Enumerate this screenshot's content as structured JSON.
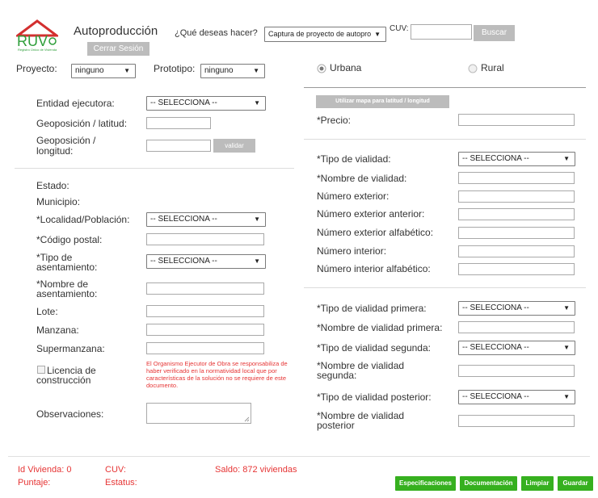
{
  "header": {
    "logo_text": "RUV",
    "logo_sub": "Registro Único de Vivienda",
    "app_title": "Autoproducción",
    "question": "¿Qué deseas hacer?",
    "action_select": "Captura de proyecto de autopro",
    "cuv_label": "CUV:",
    "cuv_value": "",
    "search_btn": "Buscar",
    "logout_btn": "Cerrar Sesión"
  },
  "filters": {
    "proyecto_label": "Proyecto:",
    "proyecto_value": "ninguno",
    "prototipo_label": "Prototipo:",
    "prototipo_value": "ninguno",
    "urbana": "Urbana",
    "rural": "Rural"
  },
  "left": {
    "entidad_label": "Entidad ejecutora:",
    "entidad_value": "-- SELECCIONA --",
    "lat_label": "Geoposición / latitud:",
    "lon_label_1": "Geoposición /",
    "lon_label_2": "longitud:",
    "validar_btn": "validar",
    "estado_label": "Estado:",
    "municipio_label": "Municipio:",
    "localidad_label": "*Localidad/Población:",
    "localidad_value": "-- SELECCIONA --",
    "cp_label": "*Código postal:",
    "tipo_asent_1": "*Tipo de",
    "tipo_asent_2": "asentamiento:",
    "tipo_asent_value": "-- SELECCIONA --",
    "nombre_asent_1": "*Nombre de",
    "nombre_asent_2": "asentamiento:",
    "lote_label": "Lote:",
    "manzana_label": "Manzana:",
    "supermanzana_label": "Supermanzana:",
    "licencia_1": "Licencia de",
    "licencia_2": "construcción",
    "licencia_note": "El Organismo Ejecutor de Obra se responsabiliza de haber verificado en la normatividad local que por características de la solución no se requiere de este documento.",
    "observaciones_label": "Observaciones:"
  },
  "right": {
    "mapa_btn": "Utilizar mapa para latitud / longitud",
    "precio_label": "*Precio:",
    "tipo_vialidad_label": "*Tipo de vialidad:",
    "tipo_vialidad_value": "-- SELECCIONA --",
    "nombre_vialidad_label": "*Nombre de vialidad:",
    "num_ext_label": "Número exterior:",
    "num_ext_ant_label": "Número exterior anterior:",
    "num_ext_alf_label": "Número exterior alfabético:",
    "num_int_label": "Número interior:",
    "num_int_alf_label": "Número interior alfabético:",
    "tipo_v1_label": "*Tipo de vialidad primera:",
    "tipo_v1_value": "-- SELECCIONA --",
    "nombre_v1_label": "*Nombre de vialidad primera:",
    "tipo_v2_label": "*Tipo de vialidad segunda:",
    "tipo_v2_value": "-- SELECCIONA --",
    "nombre_v2_1": "*Nombre de vialidad",
    "nombre_v2_2": "segunda:",
    "tipo_vp_label": "*Tipo de vialidad posterior:",
    "tipo_vp_value": "-- SELECCIONA --",
    "nombre_vp_1": "*Nombre de vialidad",
    "nombre_vp_2": "posterior"
  },
  "footer": {
    "id_vivienda": "Id Vivienda: 0",
    "cuv": "CUV:",
    "saldo": "Saldo: 872 viviendas",
    "puntaje": "Puntaje:",
    "estatus": "Estatus:",
    "btn_especificaciones": "Especificaciones",
    "btn_documentacion": "Documentación",
    "btn_limpiar": "Limpiar",
    "btn_guardar": "Guardar"
  },
  "colors": {
    "brand_red": "#d32f2f",
    "brand_green": "#36b01f",
    "footer_red": "#e63535",
    "grey_button": "#bcbcbc"
  }
}
